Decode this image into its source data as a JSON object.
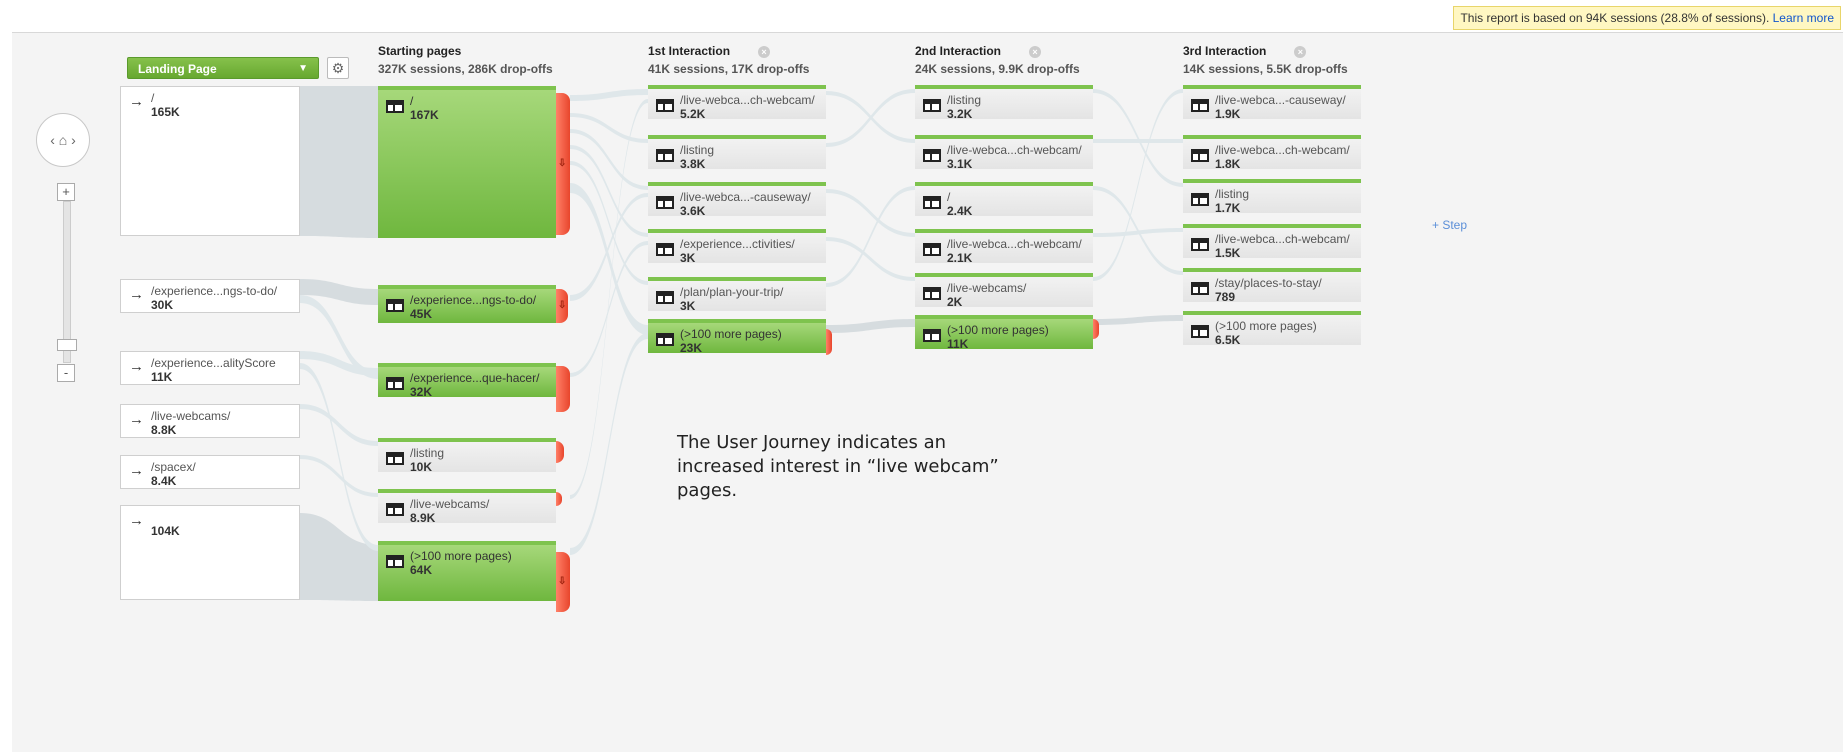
{
  "banner": {
    "text": "This report is based on 94K sessions (28.8% of sessions).",
    "link": "Learn more"
  },
  "toolbar": {
    "dimension": "Landing Page",
    "dimension_icon": "chevron-down-icon",
    "settings_icon": "gear-icon"
  },
  "columns": [
    {
      "title": "Starting pages",
      "sub": "327K sessions, 286K drop-offs"
    },
    {
      "title": "1st Interaction",
      "sub": "41K sessions, 17K drop-offs",
      "close_icon": "×"
    },
    {
      "title": "2nd Interaction",
      "sub": "24K sessions, 9.9K drop-offs",
      "close_icon": "×"
    },
    {
      "title": "3rd Interaction",
      "sub": "14K sessions, 5.5K drop-offs",
      "close_icon": "×"
    }
  ],
  "nav": {
    "home": "‹ ⌂ ›",
    "zoom_in": "+",
    "zoom_out": "-"
  },
  "landing": [
    {
      "name": "/",
      "count": "165K",
      "icon": "→"
    },
    {
      "name": "/experience...ngs-to-do/",
      "count": "30K",
      "icon": "→"
    },
    {
      "name": "/experience...alityScore",
      "count": "11K",
      "icon": "→"
    },
    {
      "name": "/live-webcams/",
      "count": "8.8K",
      "icon": "→"
    },
    {
      "name": "/spacex/",
      "count": "8.4K",
      "icon": "→"
    },
    {
      "name": "",
      "count": "104K",
      "icon": "→"
    }
  ],
  "starting": [
    {
      "name": "/",
      "count": "167K"
    },
    {
      "name": "/experience...ngs-to-do/",
      "count": "45K"
    },
    {
      "name": "/experience...que-hacer/",
      "count": "32K"
    },
    {
      "name": "/listing",
      "count": "10K"
    },
    {
      "name": "/live-webcams/",
      "count": "8.9K"
    },
    {
      "name": "(>100 more pages)",
      "count": "64K"
    }
  ],
  "first": [
    {
      "name": "/live-webca...ch-webcam/",
      "count": "5.2K"
    },
    {
      "name": "/listing",
      "count": "3.8K"
    },
    {
      "name": "/live-webca...-causeway/",
      "count": "3.6K"
    },
    {
      "name": "/experience...ctivities/",
      "count": "3K"
    },
    {
      "name": "/plan/plan-your-trip/",
      "count": "3K"
    },
    {
      "name": "(>100 more pages)",
      "count": "23K"
    }
  ],
  "second": [
    {
      "name": "/listing",
      "count": "3.2K"
    },
    {
      "name": "/live-webca...ch-webcam/",
      "count": "3.1K"
    },
    {
      "name": "/",
      "count": "2.4K"
    },
    {
      "name": "/live-webca...ch-webcam/",
      "count": "2.1K"
    },
    {
      "name": "/live-webcams/",
      "count": "2K"
    },
    {
      "name": "(>100 more pages)",
      "count": "11K"
    }
  ],
  "third": [
    {
      "name": "/live-webca...-causeway/",
      "count": "1.9K"
    },
    {
      "name": "/live-webca...ch-webcam/",
      "count": "1.8K"
    },
    {
      "name": "/listing",
      "count": "1.7K"
    },
    {
      "name": "/live-webca...ch-webcam/",
      "count": "1.5K"
    },
    {
      "name": "/stay/places-to-stay/",
      "count": "789"
    },
    {
      "name": "(>100 more pages)",
      "count": "6.5K"
    }
  ],
  "add_step": "+ Step",
  "note": "The User Journey indicates an increased interest in “live webcam” pages."
}
